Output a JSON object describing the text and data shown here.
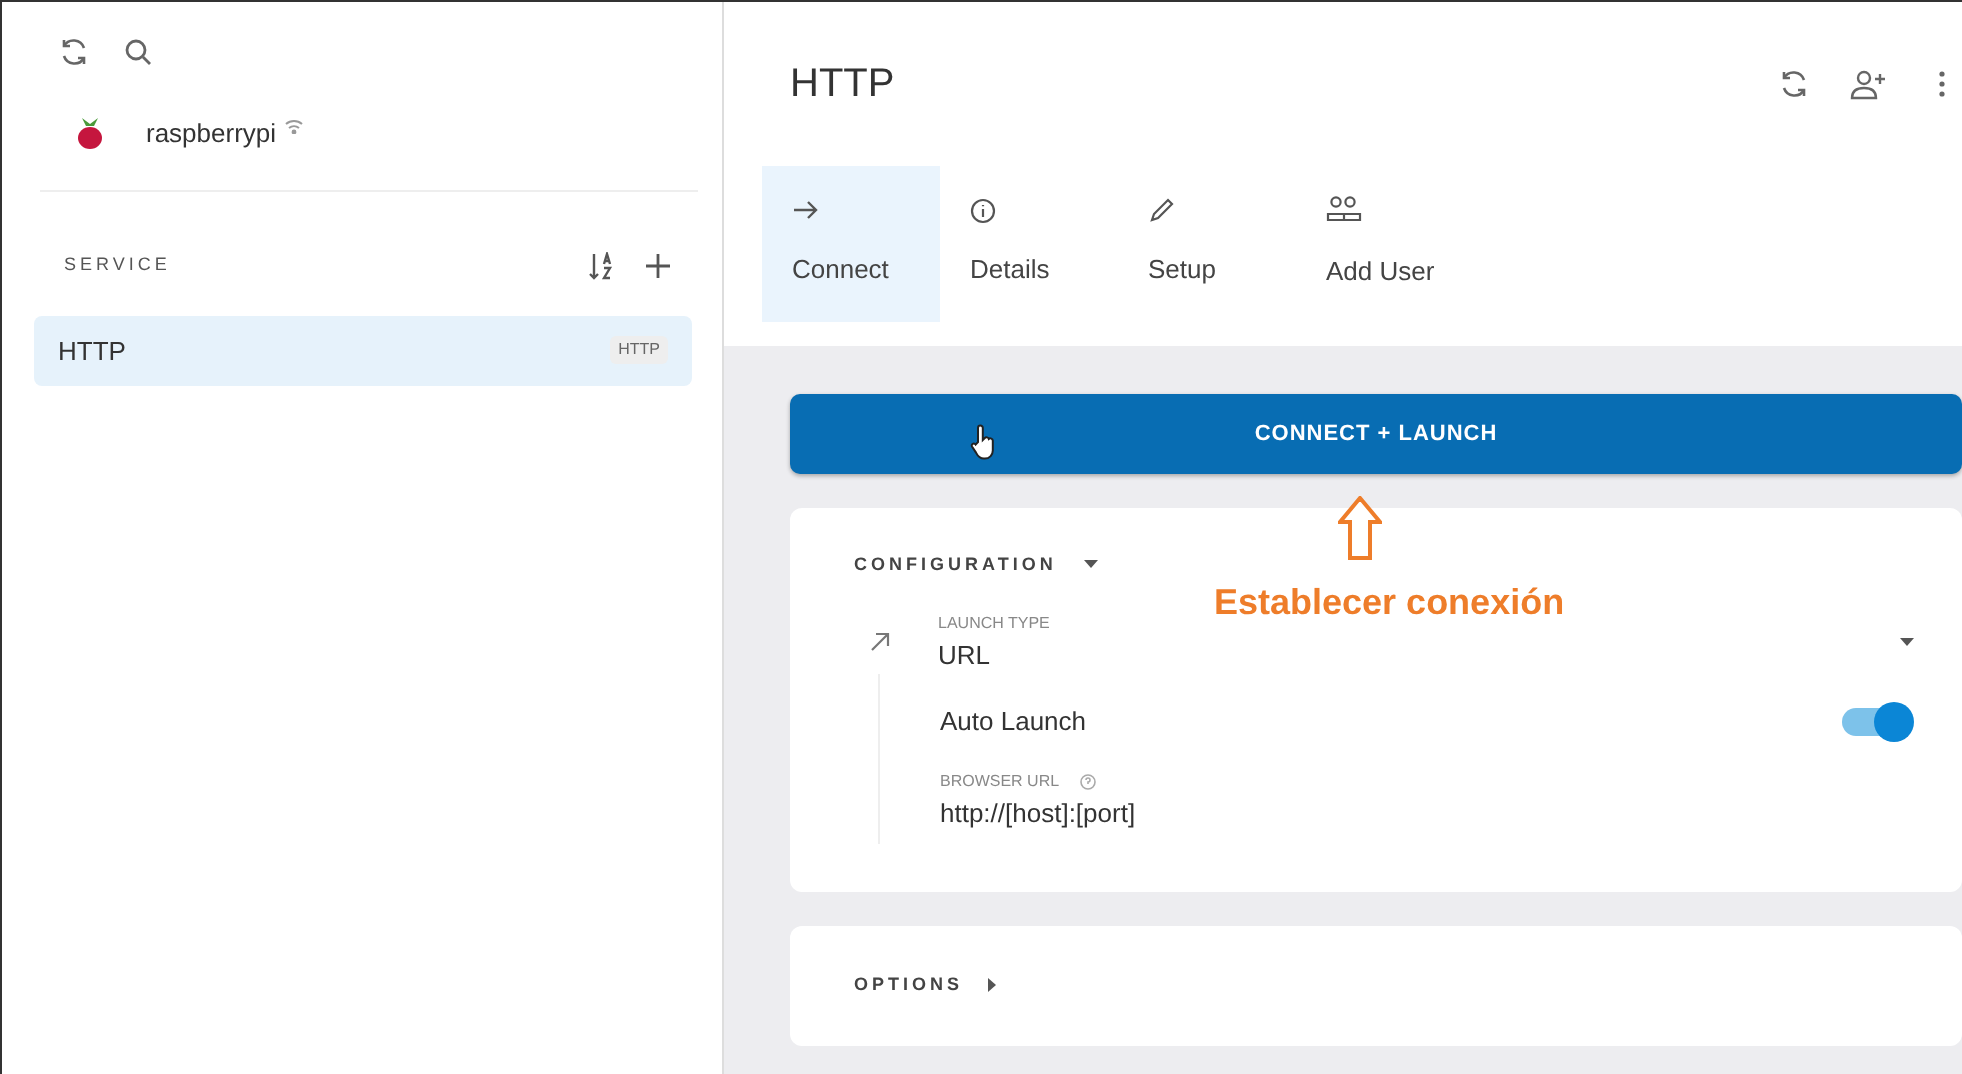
{
  "sidebar": {
    "device": {
      "name": "raspberrypi"
    },
    "section_title": "SERVICE",
    "items": [
      {
        "name": "HTTP",
        "tag": "HTTP",
        "selected": true
      }
    ]
  },
  "main": {
    "title": "HTTP",
    "tabs": [
      {
        "label": "Connect",
        "selected": true
      },
      {
        "label": "Details",
        "selected": false
      },
      {
        "label": "Setup",
        "selected": false
      },
      {
        "label": "Add User",
        "selected": false
      }
    ],
    "connect_button": "CONNECT + LAUNCH",
    "configuration": {
      "title": "CONFIGURATION",
      "expanded": true,
      "launch_type": {
        "label": "LAUNCH TYPE",
        "value": "URL"
      },
      "auto_launch": {
        "label": "Auto Launch",
        "on": true
      },
      "browser_url": {
        "label": "BROWSER URL",
        "value": "http://[host]:[port]"
      }
    },
    "options": {
      "title": "OPTIONS",
      "expanded": false
    },
    "annotation": {
      "text": "Establecer conexión"
    }
  }
}
